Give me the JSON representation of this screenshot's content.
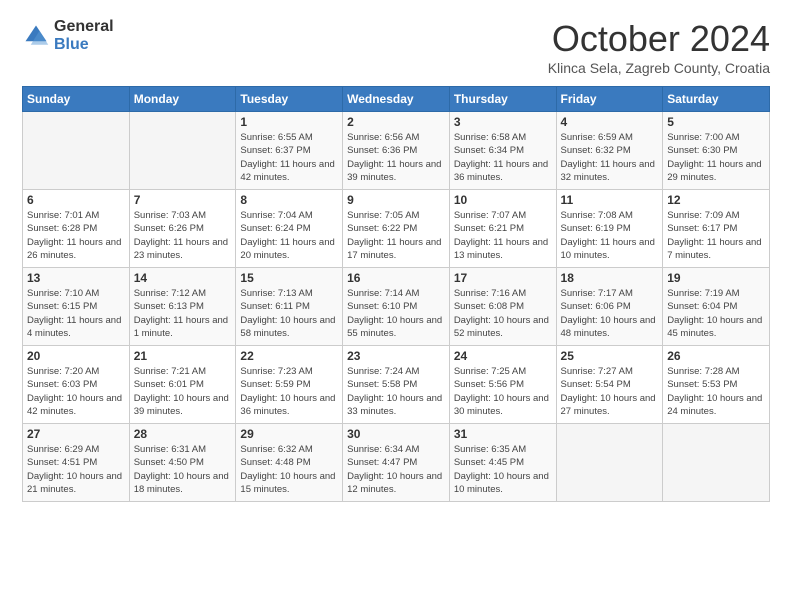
{
  "header": {
    "logo": {
      "general": "General",
      "blue": "Blue"
    },
    "title": "October 2024",
    "subtitle": "Klinca Sela, Zagreb County, Croatia"
  },
  "weekdays": [
    "Sunday",
    "Monday",
    "Tuesday",
    "Wednesday",
    "Thursday",
    "Friday",
    "Saturday"
  ],
  "weeks": [
    [
      {
        "day": "",
        "info": ""
      },
      {
        "day": "",
        "info": ""
      },
      {
        "day": "1",
        "info": "Sunrise: 6:55 AM\nSunset: 6:37 PM\nDaylight: 11 hours and 42 minutes."
      },
      {
        "day": "2",
        "info": "Sunrise: 6:56 AM\nSunset: 6:36 PM\nDaylight: 11 hours and 39 minutes."
      },
      {
        "day": "3",
        "info": "Sunrise: 6:58 AM\nSunset: 6:34 PM\nDaylight: 11 hours and 36 minutes."
      },
      {
        "day": "4",
        "info": "Sunrise: 6:59 AM\nSunset: 6:32 PM\nDaylight: 11 hours and 32 minutes."
      },
      {
        "day": "5",
        "info": "Sunrise: 7:00 AM\nSunset: 6:30 PM\nDaylight: 11 hours and 29 minutes."
      }
    ],
    [
      {
        "day": "6",
        "info": "Sunrise: 7:01 AM\nSunset: 6:28 PM\nDaylight: 11 hours and 26 minutes."
      },
      {
        "day": "7",
        "info": "Sunrise: 7:03 AM\nSunset: 6:26 PM\nDaylight: 11 hours and 23 minutes."
      },
      {
        "day": "8",
        "info": "Sunrise: 7:04 AM\nSunset: 6:24 PM\nDaylight: 11 hours and 20 minutes."
      },
      {
        "day": "9",
        "info": "Sunrise: 7:05 AM\nSunset: 6:22 PM\nDaylight: 11 hours and 17 minutes."
      },
      {
        "day": "10",
        "info": "Sunrise: 7:07 AM\nSunset: 6:21 PM\nDaylight: 11 hours and 13 minutes."
      },
      {
        "day": "11",
        "info": "Sunrise: 7:08 AM\nSunset: 6:19 PM\nDaylight: 11 hours and 10 minutes."
      },
      {
        "day": "12",
        "info": "Sunrise: 7:09 AM\nSunset: 6:17 PM\nDaylight: 11 hours and 7 minutes."
      }
    ],
    [
      {
        "day": "13",
        "info": "Sunrise: 7:10 AM\nSunset: 6:15 PM\nDaylight: 11 hours and 4 minutes."
      },
      {
        "day": "14",
        "info": "Sunrise: 7:12 AM\nSunset: 6:13 PM\nDaylight: 11 hours and 1 minute."
      },
      {
        "day": "15",
        "info": "Sunrise: 7:13 AM\nSunset: 6:11 PM\nDaylight: 10 hours and 58 minutes."
      },
      {
        "day": "16",
        "info": "Sunrise: 7:14 AM\nSunset: 6:10 PM\nDaylight: 10 hours and 55 minutes."
      },
      {
        "day": "17",
        "info": "Sunrise: 7:16 AM\nSunset: 6:08 PM\nDaylight: 10 hours and 52 minutes."
      },
      {
        "day": "18",
        "info": "Sunrise: 7:17 AM\nSunset: 6:06 PM\nDaylight: 10 hours and 48 minutes."
      },
      {
        "day": "19",
        "info": "Sunrise: 7:19 AM\nSunset: 6:04 PM\nDaylight: 10 hours and 45 minutes."
      }
    ],
    [
      {
        "day": "20",
        "info": "Sunrise: 7:20 AM\nSunset: 6:03 PM\nDaylight: 10 hours and 42 minutes."
      },
      {
        "day": "21",
        "info": "Sunrise: 7:21 AM\nSunset: 6:01 PM\nDaylight: 10 hours and 39 minutes."
      },
      {
        "day": "22",
        "info": "Sunrise: 7:23 AM\nSunset: 5:59 PM\nDaylight: 10 hours and 36 minutes."
      },
      {
        "day": "23",
        "info": "Sunrise: 7:24 AM\nSunset: 5:58 PM\nDaylight: 10 hours and 33 minutes."
      },
      {
        "day": "24",
        "info": "Sunrise: 7:25 AM\nSunset: 5:56 PM\nDaylight: 10 hours and 30 minutes."
      },
      {
        "day": "25",
        "info": "Sunrise: 7:27 AM\nSunset: 5:54 PM\nDaylight: 10 hours and 27 minutes."
      },
      {
        "day": "26",
        "info": "Sunrise: 7:28 AM\nSunset: 5:53 PM\nDaylight: 10 hours and 24 minutes."
      }
    ],
    [
      {
        "day": "27",
        "info": "Sunrise: 6:29 AM\nSunset: 4:51 PM\nDaylight: 10 hours and 21 minutes."
      },
      {
        "day": "28",
        "info": "Sunrise: 6:31 AM\nSunset: 4:50 PM\nDaylight: 10 hours and 18 minutes."
      },
      {
        "day": "29",
        "info": "Sunrise: 6:32 AM\nSunset: 4:48 PM\nDaylight: 10 hours and 15 minutes."
      },
      {
        "day": "30",
        "info": "Sunrise: 6:34 AM\nSunset: 4:47 PM\nDaylight: 10 hours and 12 minutes."
      },
      {
        "day": "31",
        "info": "Sunrise: 6:35 AM\nSunset: 4:45 PM\nDaylight: 10 hours and 10 minutes."
      },
      {
        "day": "",
        "info": ""
      },
      {
        "day": "",
        "info": ""
      }
    ]
  ]
}
